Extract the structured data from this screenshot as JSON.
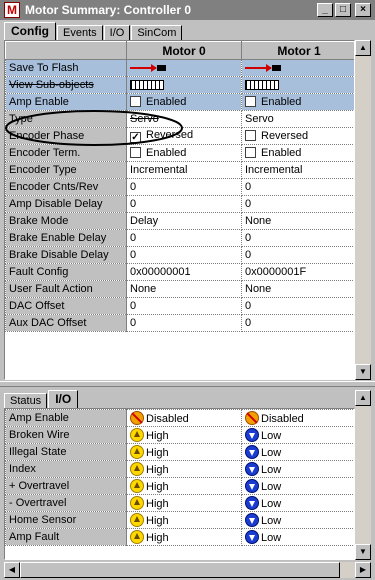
{
  "window": {
    "title": "Motor Summary: Controller 0",
    "icon_letter": "M",
    "buttons": {
      "minimize": "_",
      "maximize": "□",
      "close": "×"
    }
  },
  "tabs_top": [
    {
      "label": "Config",
      "active": true
    },
    {
      "label": "Events",
      "active": false
    },
    {
      "label": "I/O",
      "active": false
    },
    {
      "label": "SinCom",
      "active": false
    }
  ],
  "config_grid": {
    "columns": [
      "",
      "Motor 0",
      "Motor 1"
    ],
    "rows": [
      {
        "label": "Save To Flash",
        "type": "arrow-button"
      },
      {
        "label": "View Sub-objects",
        "type": "grid-button"
      },
      {
        "label": "Amp Enable",
        "type": "checkbox",
        "values": [
          "Enabled",
          "Enabled"
        ],
        "checked": [
          false,
          false
        ]
      },
      {
        "label": "Type",
        "type": "text",
        "values": [
          "Servo",
          "Servo"
        ]
      },
      {
        "label": "Encoder Phase",
        "type": "checkbox",
        "values": [
          "Reversed",
          "Reversed"
        ],
        "checked": [
          true,
          false
        ]
      },
      {
        "label": "Encoder Term.",
        "type": "checkbox",
        "values": [
          "Enabled",
          "Enabled"
        ],
        "checked": [
          false,
          false
        ]
      },
      {
        "label": "Encoder Type",
        "type": "text",
        "values": [
          "Incremental",
          "Incremental"
        ]
      },
      {
        "label": "Encoder Cnts/Rev",
        "type": "text",
        "values": [
          "0",
          "0"
        ]
      },
      {
        "label": "Amp Disable Delay",
        "type": "text",
        "values": [
          "0",
          "0"
        ]
      },
      {
        "label": "Brake Mode",
        "type": "text",
        "values": [
          "Delay",
          "None"
        ]
      },
      {
        "label": "Brake Enable Delay",
        "type": "text",
        "values": [
          "0",
          "0"
        ]
      },
      {
        "label": "Brake Disable Delay",
        "type": "text",
        "values": [
          "0",
          "0"
        ]
      },
      {
        "label": "Fault Config",
        "type": "text",
        "values": [
          "0x00000001",
          "0x0000001F"
        ]
      },
      {
        "label": "User Fault Action",
        "type": "text",
        "values": [
          "None",
          "None"
        ]
      },
      {
        "label": "DAC Offset",
        "type": "text",
        "values": [
          "0",
          "0"
        ]
      },
      {
        "label": "Aux DAC Offset",
        "type": "text",
        "values": [
          "0",
          "0"
        ]
      }
    ]
  },
  "tabs_bottom": [
    {
      "label": "Status",
      "active": false
    },
    {
      "label": "I/O",
      "active": true
    }
  ],
  "io_grid": {
    "rows": [
      {
        "label": "Amp Enable",
        "values": [
          "Disabled",
          "Disabled"
        ],
        "icons": [
          "disabled-icon",
          "disabled-icon"
        ]
      },
      {
        "label": "Broken Wire",
        "values": [
          "High",
          "Low"
        ],
        "icons": [
          "high-icon",
          "low-icon"
        ]
      },
      {
        "label": "Illegal State",
        "values": [
          "High",
          "Low"
        ],
        "icons": [
          "high-icon",
          "low-icon"
        ]
      },
      {
        "label": "Index",
        "values": [
          "High",
          "Low"
        ],
        "icons": [
          "high-icon",
          "low-icon"
        ]
      },
      {
        "label": "+ Overtravel",
        "values": [
          "High",
          "Low"
        ],
        "icons": [
          "high-icon",
          "low-icon"
        ]
      },
      {
        "label": "- Overtravel",
        "values": [
          "High",
          "Low"
        ],
        "icons": [
          "high-icon",
          "low-icon"
        ]
      },
      {
        "label": "Home Sensor",
        "values": [
          "High",
          "Low"
        ],
        "icons": [
          "high-icon",
          "low-icon"
        ]
      },
      {
        "label": "Amp Fault",
        "values": [
          "High",
          "Low"
        ],
        "icons": [
          "high-icon",
          "low-icon"
        ]
      }
    ]
  },
  "colors": {
    "highlight_row": "#a8bfdc",
    "title_bar": "#808080",
    "face": "#c0c0c0"
  }
}
